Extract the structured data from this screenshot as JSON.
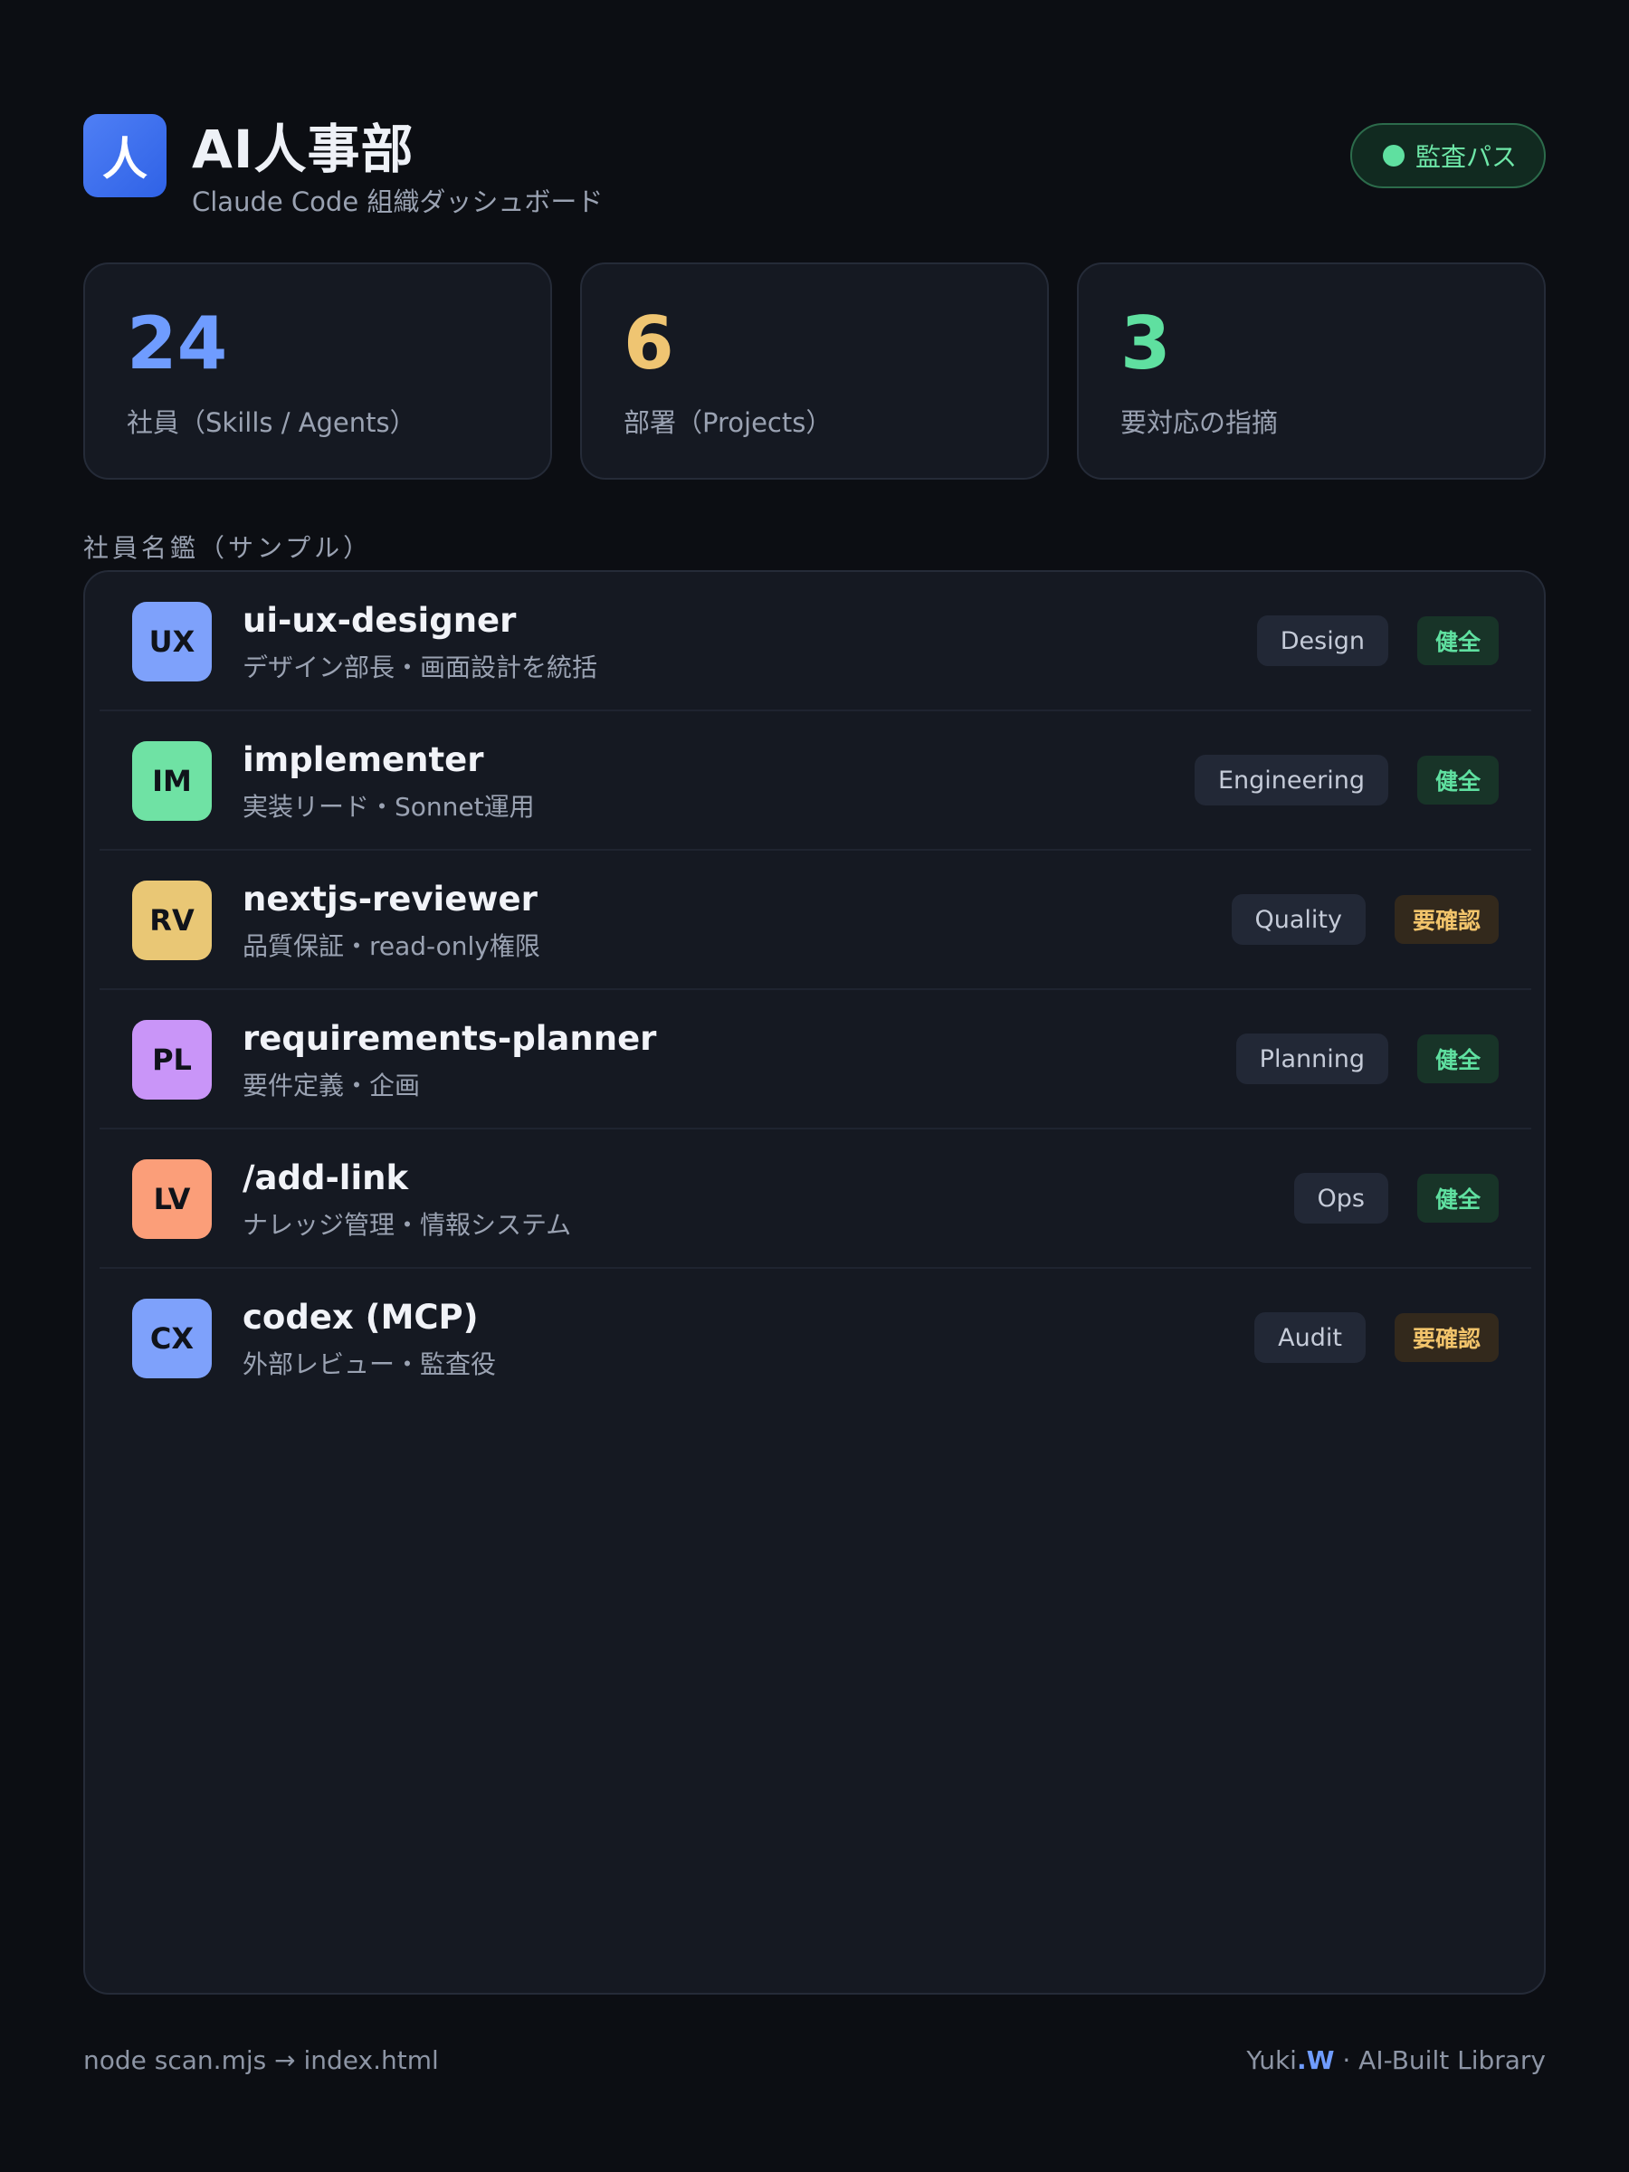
{
  "header": {
    "logo_glyph": "人",
    "title": "AI人事部",
    "subtitle": "Claude Code 組織ダッシュボード",
    "audit_status": "監査パス",
    "audit_color": "#5fe0a0"
  },
  "stats": [
    {
      "value": "24",
      "label": "社員（Skills / Agents）",
      "color": "#6f9cff"
    },
    {
      "value": "6",
      "label": "部署（Projects）",
      "color": "#efc572"
    },
    {
      "value": "3",
      "label": "要対応の指摘",
      "color": "#5fe0a0"
    }
  ],
  "roster": {
    "title": "社員名鑑（サンプル）",
    "members": [
      {
        "initials": "UX",
        "name": "ui-ux-designer",
        "desc": "デザイン部長・画面設計を統括",
        "dept": "Design",
        "status": "健全",
        "status_type": "ok",
        "avatar_color": "#7ea1fb"
      },
      {
        "initials": "IM",
        "name": "implementer",
        "desc": "実装リード・Sonnet運用",
        "dept": "Engineering",
        "status": "健全",
        "status_type": "ok",
        "avatar_color": "#6fe2a4"
      },
      {
        "initials": "RV",
        "name": "nextjs-reviewer",
        "desc": "品質保証・read-only権限",
        "dept": "Quality",
        "status": "要確認",
        "status_type": "warn",
        "avatar_color": "#e9c775"
      },
      {
        "initials": "PL",
        "name": "requirements-planner",
        "desc": "要件定義・企画",
        "dept": "Planning",
        "status": "健全",
        "status_type": "ok",
        "avatar_color": "#c995f8"
      },
      {
        "initials": "LV",
        "name": "/add-link",
        "desc": "ナレッジ管理・情報システム",
        "dept": "Ops",
        "status": "健全",
        "status_type": "ok",
        "avatar_color": "#fb9e79"
      },
      {
        "initials": "CX",
        "name": "codex (MCP)",
        "desc": "外部レビュー・監査役",
        "dept": "Audit",
        "status": "要確認",
        "status_type": "warn",
        "avatar_color": "#7ea1fb"
      }
    ]
  },
  "footer": {
    "command": "node scan.mjs → index.html",
    "brand_name": "Yuki",
    "brand_accent": ".W",
    "brand_suffix": " · AI-Built Library"
  }
}
